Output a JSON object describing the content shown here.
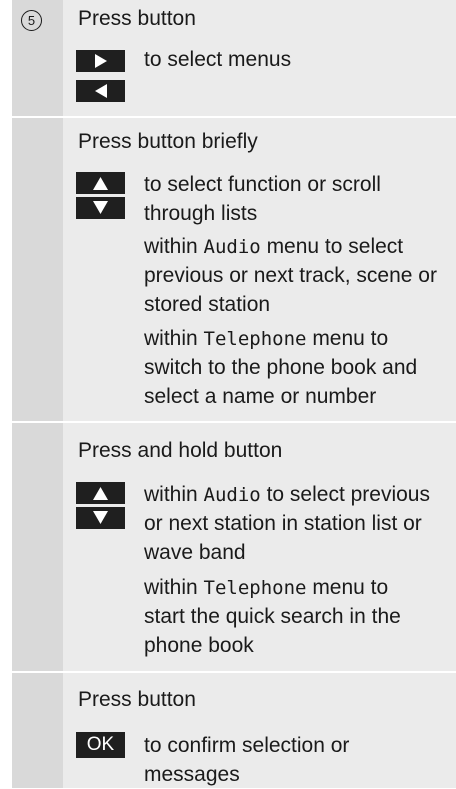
{
  "step": {
    "number": "5",
    "sections": [
      {
        "heading": "Press button",
        "buttons": [
          "right-arrow-icon",
          "left-arrow-icon"
        ],
        "lines": [
          "to select menus"
        ]
      },
      {
        "heading": "Press button briefly",
        "buttons": [
          "up-arrow-icon",
          "down-arrow-icon"
        ],
        "desc_lines": [
          "to select function or scroll",
          "through lists"
        ],
        "audio": {
          "prefix": "within ",
          "keyword": "Audio",
          "suffix": " menu to select",
          "lines": [
            "previous or next track, scene or",
            "stored station"
          ]
        },
        "telephone": {
          "prefix": "within ",
          "keyword": "Telephone",
          "suffix": " menu to",
          "lines": [
            "switch to the phone book and",
            "select a name or number"
          ]
        }
      },
      {
        "heading": "Press and hold button",
        "buttons": [
          "up-arrow-icon",
          "down-arrow-icon"
        ],
        "audio": {
          "prefix": "within ",
          "keyword": "Audio",
          "suffix": " to select previous",
          "lines": [
            "or next station in station list or",
            "wave band"
          ]
        },
        "telephone": {
          "prefix": "within ",
          "keyword": "Telephone",
          "suffix": " menu to",
          "lines": [
            "start the quick search in the",
            "phone book"
          ]
        }
      },
      {
        "heading": "Press button",
        "button_label": "OK",
        "lines": [
          "to confirm selection or",
          "messages"
        ]
      }
    ]
  }
}
